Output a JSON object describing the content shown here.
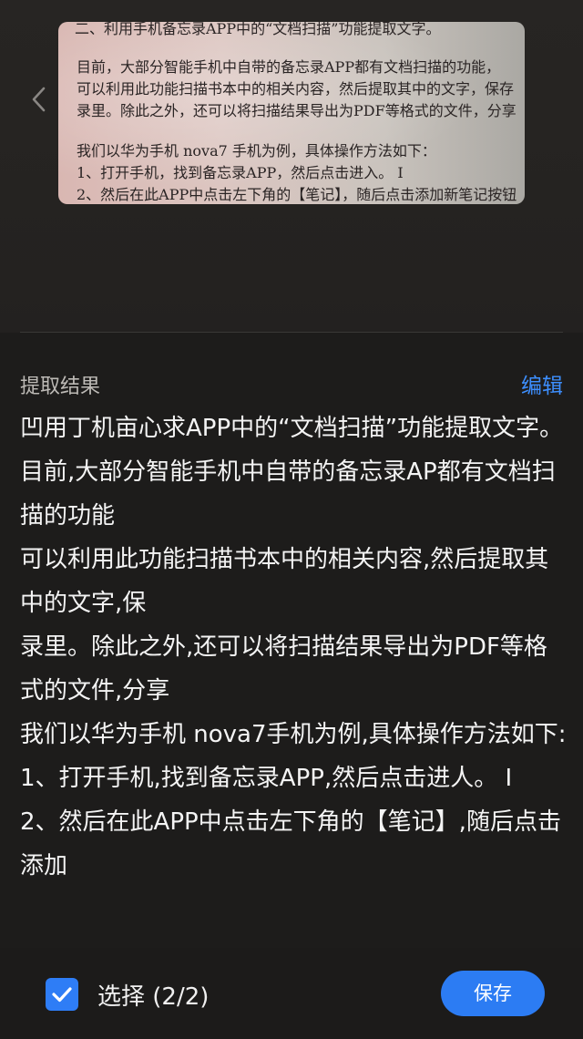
{
  "scan": {
    "lines": [
      "二、利用手机备忘录APP中的“文档扫描”功能提取文字。",
      "目前，大部分智能手机中自带的备忘录APP都有文档扫描的功能，",
      "可以利用此功能扫描书本中的相关内容，然后提取其中的文字，保存",
      "录里。除此之外，还可以将扫描结果导出为PDF等格式的文件，分享",
      "我们以华为手机 nova7 手机为例，具体操作方法如下：",
      "1、打开手机，找到备忘录APP，然后点击进入。 I",
      "2、然后在此APP中点击左下角的【笔记】，随后点击添加新笔记按钮"
    ]
  },
  "result": {
    "title": "提取结果",
    "edit_label": "编辑",
    "paragraphs": [
      "凹用丁机亩心求APP中的“文档扫描”功能提取文字。",
      "目前,大部分智能手机中自带的备忘录AP都有文档扫描的功能",
      "可以利用此功能扫描书本中的相关内容,然后提取其中的文字,保",
      "录里。除此之外,还可以将扫描结果导出为PDF等格式的文件,分享",
      "我们以华为手机 nova7手机为例,具体操作方法如下:",
      "1、打开手机,找到备忘录APP,然后点击进人。 I",
      "2、然后在此APP中点击左下角的【笔记】,随后点击添加"
    ]
  },
  "bottom": {
    "select_label": "选择 (2/2)",
    "checked": true,
    "save_label": "保存"
  },
  "colors": {
    "accent": "#2c7cf3",
    "link": "#3d8fff",
    "background": "#1d1c1b"
  },
  "icons": [
    "chevron-left-icon",
    "checkmark-icon"
  ]
}
